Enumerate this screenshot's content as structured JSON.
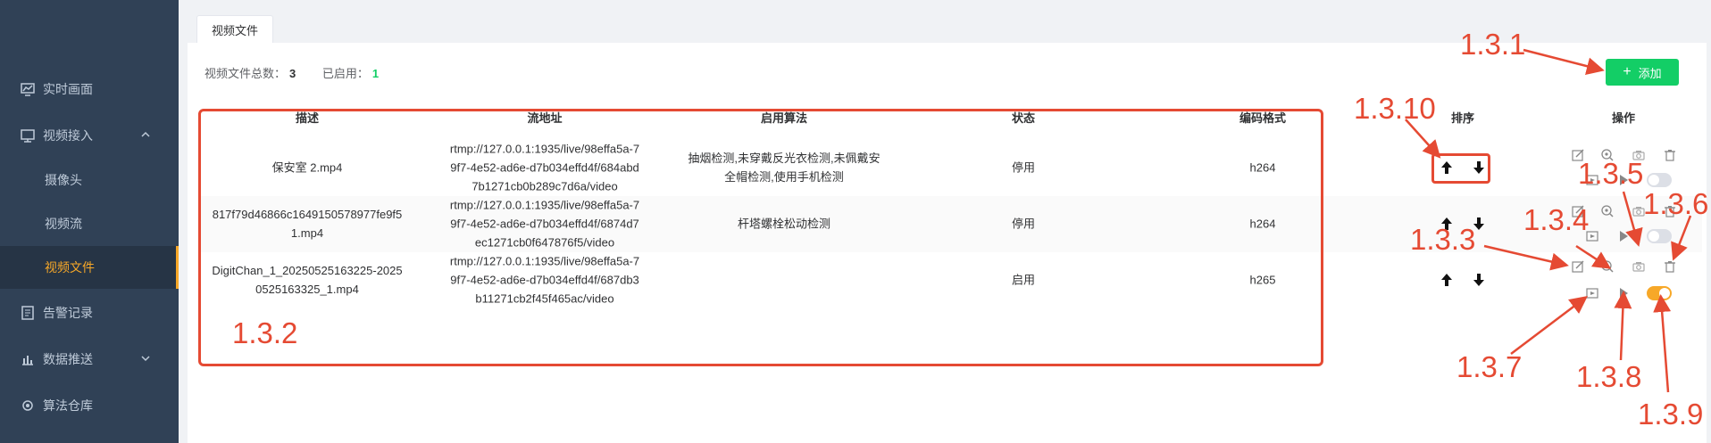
{
  "sidebar": {
    "items": [
      {
        "label": "实时画面",
        "icon": "monitor-chart-icon"
      },
      {
        "label": "视频接入",
        "icon": "desktop-icon",
        "expanded": true,
        "children": [
          "摄像头",
          "视频流",
          "视频文件"
        ]
      },
      {
        "label": "告警记录",
        "icon": "document-icon"
      },
      {
        "label": "数据推送",
        "icon": "chart-bar-icon",
        "expanded": false
      },
      {
        "label": "算法仓库",
        "icon": "gear-icon"
      }
    ],
    "active_child": "视频文件"
  },
  "tab": {
    "label": "视频文件"
  },
  "stats": {
    "total_label": "视频文件总数：",
    "total_value": "3",
    "enabled_label": "已启用：",
    "enabled_value": "1"
  },
  "toolbar": {
    "add_label": "添加"
  },
  "table": {
    "columns": [
      "描述",
      "流地址",
      "启用算法",
      "状态",
      "编码格式",
      "排序",
      "操作"
    ],
    "rows": [
      {
        "description": "保安室 2.mp4",
        "url": [
          "rtmp://127.0.0.1:1935/live/98effa5a-7",
          "9f7-4e52-ad6e-d7b034effd4f/684abd",
          "7b1271cb0b289c7d6a/video"
        ],
        "algorithm": [
          "抽烟检测,未穿戴反光衣检测,未佩戴安",
          "全帽检测,使用手机检测"
        ],
        "status": "停用",
        "codec": "h264",
        "enabled": false
      },
      {
        "description": [
          "817f79d46866c1649150578977fe9f5",
          "1.mp4"
        ],
        "url": [
          "rtmp://127.0.0.1:1935/live/98effa5a-7",
          "9f7-4e52-ad6e-d7b034effd4f/6874d7",
          "ec1271cb0f647876f5/video"
        ],
        "algorithm": [
          "杆塔螺栓松动检测"
        ],
        "status": "停用",
        "codec": "h264",
        "enabled": false
      },
      {
        "description": [
          "DigitChan_1_20250525163225-2025",
          "0525163325_1.mp4"
        ],
        "url": [
          "rtmp://127.0.0.1:1935/live/98effa5a-7",
          "9f7-4e52-ad6e-d7b034effd4f/687db3",
          "b11271cb2f45f465ac/video"
        ],
        "algorithm": [],
        "status": "启用",
        "codec": "h265",
        "enabled": true
      }
    ]
  },
  "annotations": [
    "1.3.1",
    "1.3.2",
    "1.3.3",
    "1.3.4",
    "1.3.5",
    "1.3.6",
    "1.3.7",
    "1.3.8",
    "1.3.9",
    "1.3.10"
  ],
  "colors": {
    "sidebar_bg": "#304156",
    "sidebar_text": "#bfcbd9",
    "active_accent": "#f7a828",
    "add_button": "#13ce66",
    "enabled_count": "#13ce66",
    "annotation_red": "#e54a33",
    "toggle_on": "#f7a828",
    "toggle_off": "#dcdfe6"
  }
}
